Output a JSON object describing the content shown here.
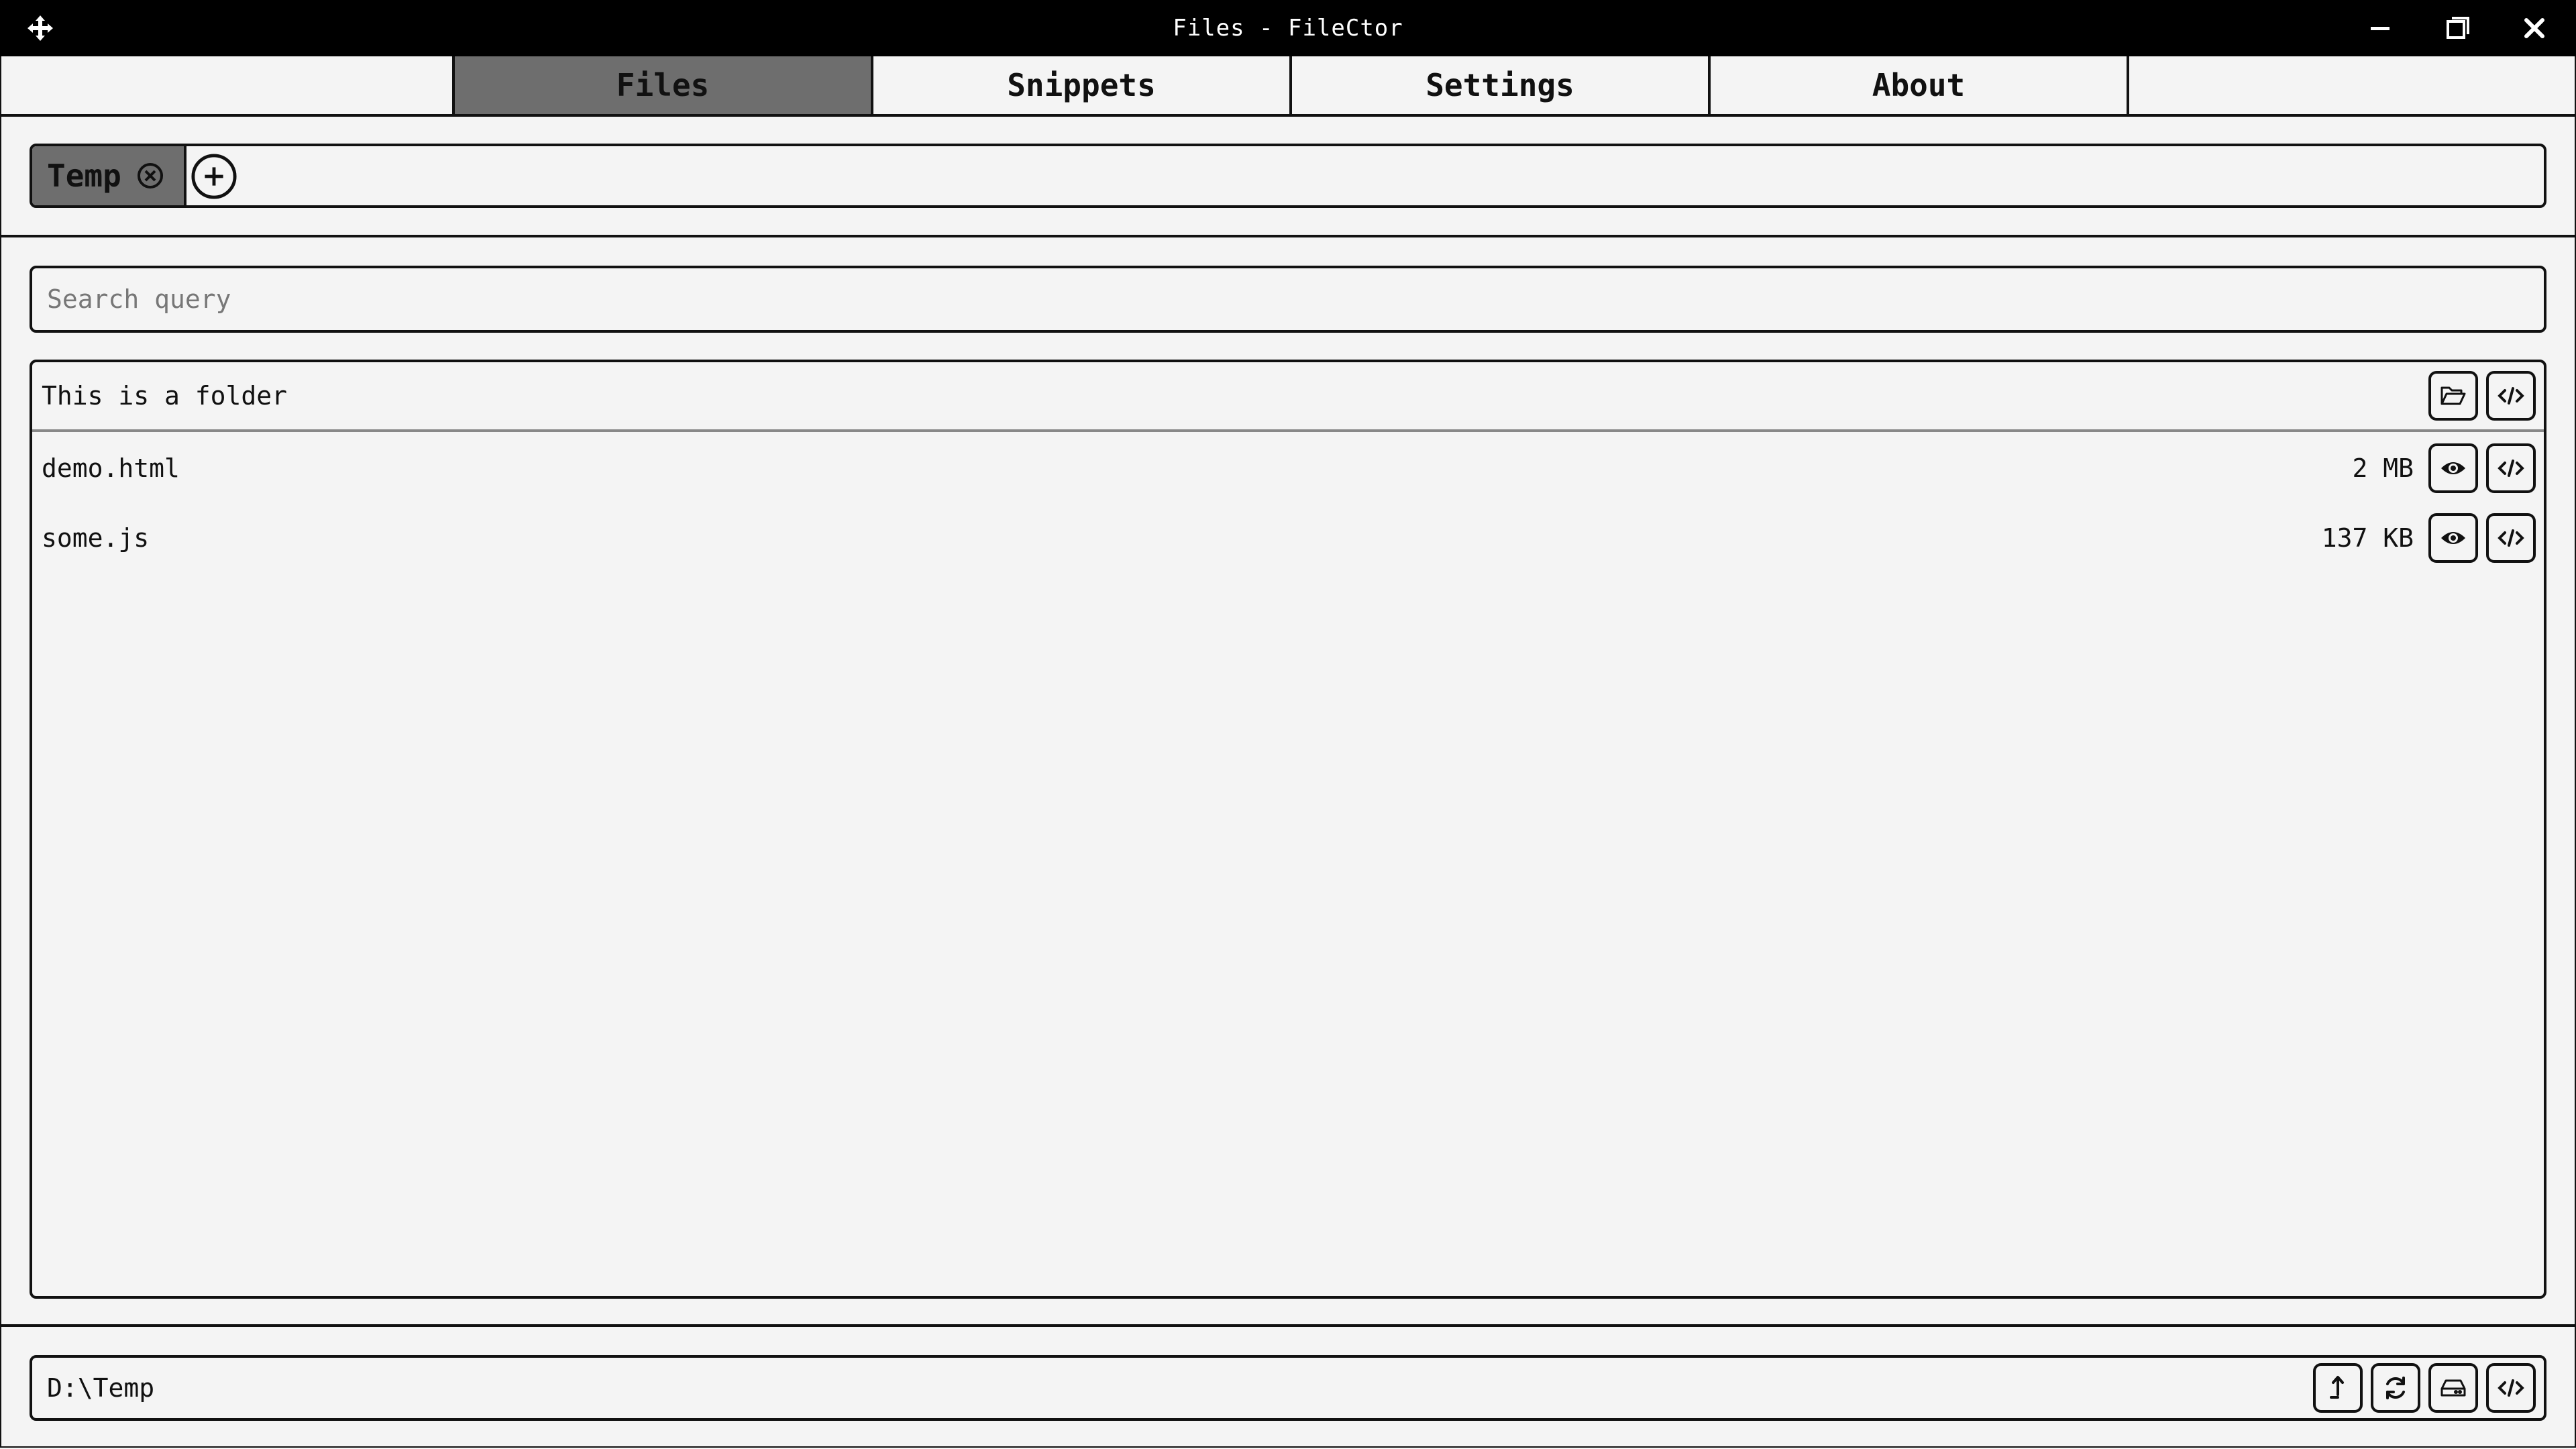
{
  "window": {
    "title": "Files - FileCtor"
  },
  "tabs": [
    {
      "label": "Files",
      "active": true
    },
    {
      "label": "Snippets",
      "active": false
    },
    {
      "label": "Settings",
      "active": false
    },
    {
      "label": "About",
      "active": false
    }
  ],
  "projects": {
    "current": "Temp"
  },
  "search": {
    "placeholder": "Search query",
    "value": ""
  },
  "files": {
    "folder_row": {
      "name": "This is a folder"
    },
    "items": [
      {
        "name": "demo.html",
        "size": "2 MB"
      },
      {
        "name": "some.js",
        "size": "137 KB"
      }
    ]
  },
  "pathbar": {
    "path": "D:\\Temp"
  },
  "icons": {
    "move": "move-icon",
    "minimize": "minimize-icon",
    "maximize": "maximize-icon",
    "close": "close-icon",
    "folder_open": "folder-open-icon",
    "code": "code-icon",
    "eye": "eye-icon",
    "up": "arrow-up-icon",
    "refresh": "refresh-icon",
    "drive": "drive-icon",
    "add": "plus-circle-icon",
    "tab_close": "x-circle-icon"
  },
  "colors": {
    "background": "#f4f4f4",
    "active_tab": "#6e6e6e",
    "titlebar": "#000000"
  }
}
